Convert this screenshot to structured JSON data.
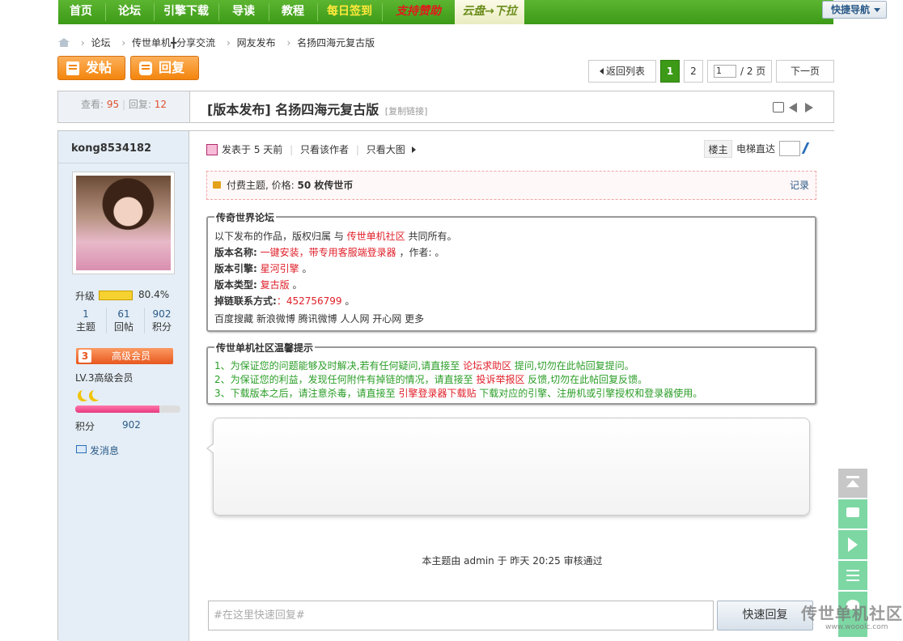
{
  "nav": {
    "items": [
      "首页",
      "论坛",
      "引擎下载",
      "导读",
      "教程",
      "每日签到",
      "支持赞助",
      "云盘→下拉"
    ],
    "quick_nav": "快捷导航"
  },
  "breadcrumb": [
    "论坛",
    "传世单机╋分享交流",
    "网友发布",
    "名扬四海元复古版"
  ],
  "actions": {
    "post": "发帖",
    "reply": "回复"
  },
  "pager": {
    "back": "返回列表",
    "current": "1",
    "page2": "2",
    "input": "1",
    "total": "/ 2 页",
    "next": "下一页"
  },
  "thread": {
    "views_label": "查看:",
    "views": "95",
    "replies_label": "回复:",
    "replies": "12",
    "title": "[版本发布] 名扬四海元复古版",
    "copy_link": "[复制链接]"
  },
  "author": {
    "name": "kong8534182",
    "upgrade_label": "升级",
    "upgrade_pct": "80.4%",
    "upgrade_fraction": 0.804,
    "stats": [
      {
        "value": "1",
        "label": "主题"
      },
      {
        "value": "61",
        "label": "回帖"
      },
      {
        "value": "902",
        "label": "积分"
      }
    ],
    "rank_num": "3",
    "rank_title": "高级会员",
    "rank_name": "LV.3高级会员",
    "xp_fraction": 0.8,
    "points_label": "积分",
    "points": "902",
    "send_msg": "发消息"
  },
  "post": {
    "posted": "发表于 5 天前",
    "only_author": "只看该作者",
    "big_image": "只看大图",
    "floor": "楼主",
    "elevator": "电梯直达",
    "paid_prefix": "付费主题, 价格: ",
    "paid_price": "50 枚传世币",
    "paid_record": "记录",
    "box1": {
      "legend": "传奇世界论坛",
      "line1_a": "以下发布的作品，版权归属    与 ",
      "line1_b": "传世单机社区",
      "line1_c": " 共同所有。",
      "line2_label": "版本名称:",
      "line2_val": " 一键安装，带专用客服端登录器",
      "line2_c": " ，作者:   。",
      "line3_label": "版本引擎:",
      "line3_val": " 星河引擎",
      "line3_c": "   。",
      "line4_label": "版本类型:",
      "line4_val": " 复古版",
      "line4_c": "   。",
      "line5_label": "掉链联系方式:",
      "line5_val": "：452756799",
      "line5_c": "  。",
      "share": "百度搜藏 新浪微博 腾讯微博 人人网 开心网 更多"
    },
    "box2": {
      "legend": "传世单机社区温馨提示",
      "tip1_a": "1、为保证您的问题能够及时解决,若有任何疑问,请直接至 ",
      "tip1_b": "论坛求助区",
      "tip1_c": " 提问,切勿在此帖回复提问。",
      "tip2_a": "2、为保证您的利益，发现任何附件有掉链的情况，请直接至 ",
      "tip2_b": "投诉举报区",
      "tip2_c": " 反馈,切勿在此帖回复反馈。",
      "tip3_a": "3、下载版本之后，请注意杀毒，请直接至 ",
      "tip3_b": "引擎登录器下载贴",
      "tip3_c": " 下载对应的引擎、注册机或引擎授权和登录器使用。"
    },
    "audit_note": "本主题由 admin 于 昨天 20:25 审核通过",
    "quick_placeholder": "#在这里快速回复#",
    "quick_button": "快速回复"
  },
  "watermark": {
    "text": "传世单机社区",
    "url": "www.wooolc.com"
  },
  "colors": {
    "nav_green": "#3c9a16",
    "accent_orange": "#f3850d",
    "link_red": "#e0202a",
    "link_blue": "#2b5a88"
  }
}
